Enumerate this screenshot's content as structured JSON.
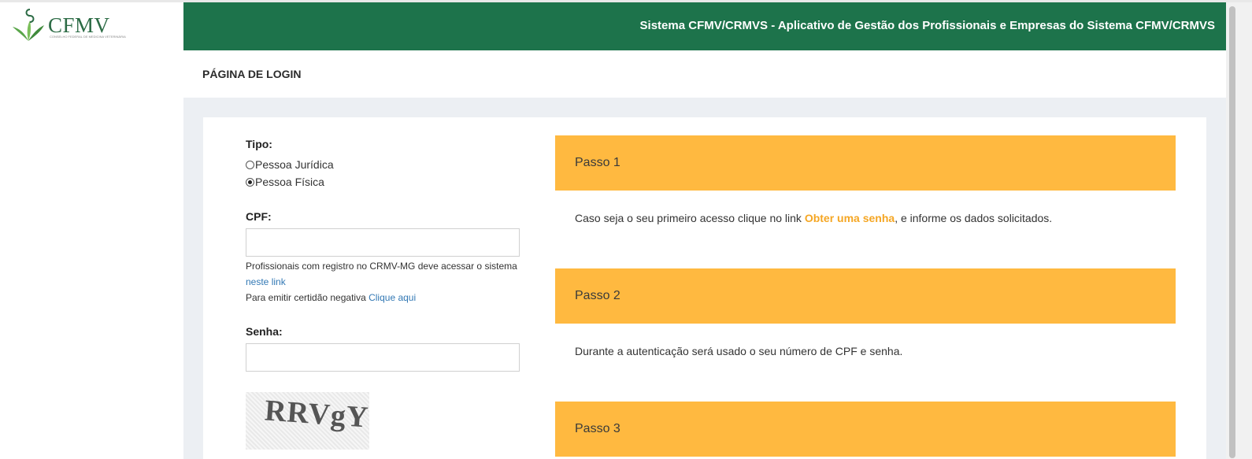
{
  "logo": {
    "text": "CFMV",
    "subtitle": "CONSELHO FEDERAL DE MEDICINA VETERINÁRIA"
  },
  "header": {
    "title": "Sistema CFMV/CRMVS - Aplicativo de Gestão dos Profissionais e Empresas do Sistema CFMV/CRMVS"
  },
  "page": {
    "title": "PÁGINA DE LOGIN"
  },
  "form": {
    "tipo_label": "Tipo:",
    "options": [
      {
        "label": "Pessoa Jurídica",
        "checked": false
      },
      {
        "label": "Pessoa Física",
        "checked": true
      }
    ],
    "cpf_label": "CPF:",
    "cpf_value": "",
    "help_line1": "Profissionais com registro no CRMV-MG deve acessar o sistema",
    "help_link1": "neste link",
    "help_line2": "Para emitir certidão negativa",
    "help_link2": "Clique aqui",
    "senha_label": "Senha:",
    "senha_value": "",
    "captcha_text": "RRVgY"
  },
  "steps": [
    {
      "title": "Passo 1",
      "text_before": "Caso seja o seu primeiro acesso clique no link ",
      "link": "Obter uma senha",
      "text_after": ", e informe os dados solicitados."
    },
    {
      "title": "Passo 2",
      "text": "Durante a autenticação será usado o seu número de CPF e senha."
    },
    {
      "title": "Passo 3"
    }
  ],
  "colors": {
    "header": "#1d734b",
    "step": "#ffb940",
    "link": "#3278b4",
    "step_link": "#f5a623",
    "content_bg": "#eceff3"
  }
}
